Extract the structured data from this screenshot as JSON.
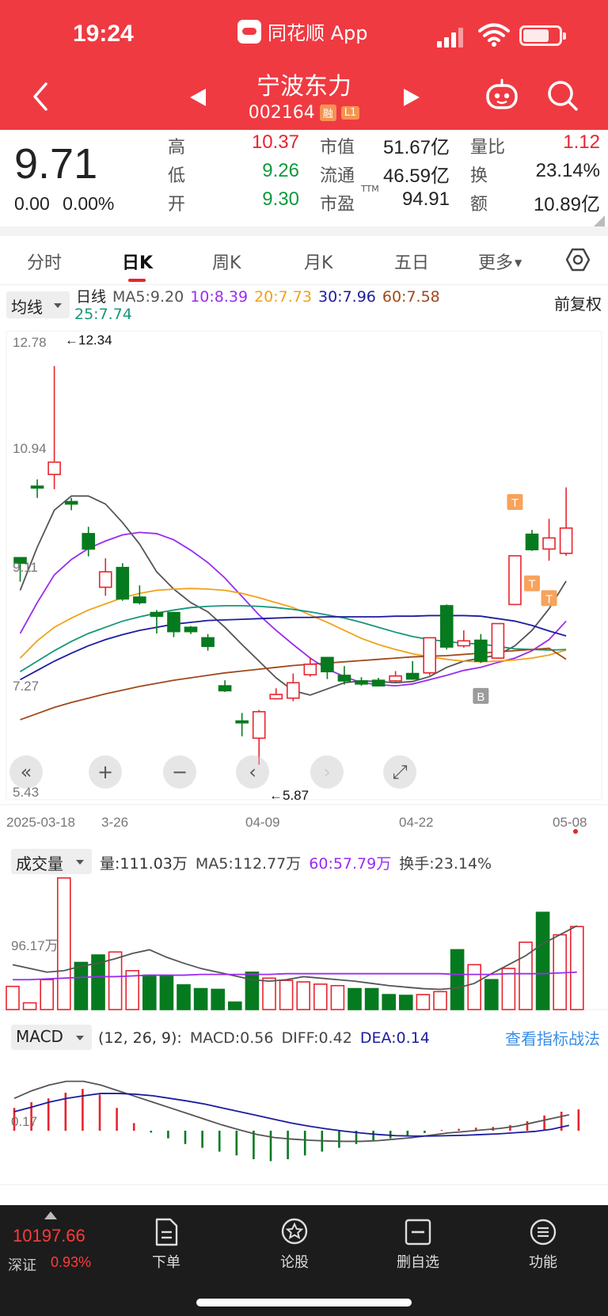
{
  "status_bar": {
    "time": "19:24",
    "app_name": "同花顺 App"
  },
  "header": {
    "stock_name": "宁波东力",
    "stock_code": "002164",
    "tags": [
      "融",
      "L1"
    ],
    "icons": [
      "back-icon",
      "prev-stock-icon",
      "next-stock-icon",
      "robot-icon",
      "search-icon"
    ]
  },
  "quote": {
    "price": "9.71",
    "change": "0.00",
    "change_pct": "0.00%",
    "high_label": "高",
    "high": "10.37",
    "low_label": "低",
    "low": "9.26",
    "open_label": "开",
    "open": "9.30",
    "mcap_label": "市值",
    "mcap": "51.67亿",
    "float_label": "流通",
    "float": "46.59亿",
    "pe_label": "市盈",
    "pe_sup": "TTM",
    "pe": "94.91",
    "volratio_label": "量比",
    "volratio": "1.12",
    "turnover_label": "换",
    "turnover": "23.14%",
    "amount_label": "额",
    "amount": "10.89亿"
  },
  "tabs": [
    "分时",
    "日K",
    "周K",
    "月K",
    "五日",
    "更多"
  ],
  "ma_legend": {
    "selector": "均线",
    "period": "日线",
    "ma5": "MA5:9.20",
    "ma10": "10:8.39",
    "ma20": "20:7.73",
    "ma30": "30:7.96",
    "ma60": "60:7.58",
    "ma25": "25:7.74",
    "fuquan": "前复权"
  },
  "colors": {
    "up": "#e8242e",
    "down": "#067a1e",
    "ma5": "#555555",
    "ma10": "#9a2cf0",
    "ma20": "#f2a218",
    "ma30": "#1c1ca0",
    "ma60": "#a0491a",
    "ma25": "#17967a"
  },
  "chart_data": [
    {
      "type": "candlestick",
      "price_axis": [
        "12.78",
        "10.94",
        "9.11",
        "7.27",
        "5.43"
      ],
      "ylim": [
        5.43,
        12.78
      ],
      "date_labels": [
        "2025-03-18",
        "3-26",
        "04-09",
        "04-22",
        "05-08"
      ],
      "annotations": {
        "high": "←12.34",
        "low": "←5.87",
        "trade_marks": [
          "T",
          "T",
          "T",
          "B"
        ]
      },
      "candles": [
        {
          "o": 9.23,
          "c": 9.14,
          "h": 9.24,
          "l": 8.84
        },
        {
          "o": 10.39,
          "c": 10.36,
          "h": 10.5,
          "l": 10.2
        },
        {
          "o": 10.58,
          "c": 10.78,
          "h": 12.34,
          "l": 10.34
        },
        {
          "o": 10.14,
          "c": 10.1,
          "h": 10.2,
          "l": 10.0
        },
        {
          "o": 9.62,
          "c": 9.37,
          "h": 9.73,
          "l": 9.25
        },
        {
          "o": 8.75,
          "c": 9.0,
          "h": 9.22,
          "l": 8.61
        },
        {
          "o": 9.07,
          "c": 8.56,
          "h": 9.14,
          "l": 8.53
        },
        {
          "o": 8.59,
          "c": 8.5,
          "h": 8.78,
          "l": 8.47
        },
        {
          "o": 8.34,
          "c": 8.28,
          "h": 8.38,
          "l": 8.0
        },
        {
          "o": 8.34,
          "c": 8.03,
          "h": 8.34,
          "l": 7.94
        },
        {
          "o": 8.1,
          "c": 8.03,
          "h": 8.12,
          "l": 7.99
        },
        {
          "o": 7.93,
          "c": 7.79,
          "h": 7.99,
          "l": 7.72
        },
        {
          "o": 7.15,
          "c": 7.07,
          "h": 7.24,
          "l": 7.05
        },
        {
          "o": 6.58,
          "c": 6.55,
          "h": 6.71,
          "l": 6.33
        },
        {
          "o": 6.3,
          "c": 6.73,
          "h": 6.76,
          "l": 5.87
        },
        {
          "o": 6.94,
          "c": 7.01,
          "h": 7.11,
          "l": 6.93
        },
        {
          "o": 6.95,
          "c": 7.2,
          "h": 7.35,
          "l": 6.9
        },
        {
          "o": 7.33,
          "c": 7.5,
          "h": 7.61,
          "l": 7.3
        },
        {
          "o": 7.61,
          "c": 7.38,
          "h": 7.61,
          "l": 7.26
        },
        {
          "o": 7.32,
          "c": 7.23,
          "h": 7.47,
          "l": 7.17
        },
        {
          "o": 7.23,
          "c": 7.18,
          "h": 7.29,
          "l": 7.15
        },
        {
          "o": 7.24,
          "c": 7.15,
          "h": 7.28,
          "l": 7.14
        },
        {
          "o": 7.23,
          "c": 7.31,
          "h": 7.39,
          "l": 7.21
        },
        {
          "o": 7.35,
          "c": 7.26,
          "h": 7.55,
          "l": 7.25
        },
        {
          "o": 7.36,
          "c": 7.93,
          "h": 7.93,
          "l": 7.32
        },
        {
          "o": 8.45,
          "c": 7.78,
          "h": 8.47,
          "l": 7.74
        },
        {
          "o": 7.8,
          "c": 7.88,
          "h": 8.05,
          "l": 7.77
        },
        {
          "o": 7.89,
          "c": 7.55,
          "h": 7.99,
          "l": 7.52
        },
        {
          "o": 7.6,
          "c": 8.16,
          "h": 8.16,
          "l": 7.59
        },
        {
          "o": 8.47,
          "c": 9.26,
          "h": 9.26,
          "l": 8.47
        },
        {
          "o": 9.61,
          "c": 9.36,
          "h": 9.68,
          "l": 9.34
        },
        {
          "o": 9.37,
          "c": 9.55,
          "h": 9.86,
          "l": 9.18
        },
        {
          "o": 9.3,
          "c": 9.71,
          "h": 10.37,
          "l": 9.26
        }
      ],
      "series": [
        {
          "name": "MA5",
          "values": [
            8.7,
            9.4,
            10.0,
            10.23,
            10.23,
            10.1,
            9.8,
            9.45,
            9.0,
            8.72,
            8.5,
            8.35,
            8.1,
            7.82,
            7.55,
            7.28,
            7.07,
            7.0,
            7.1,
            7.2,
            7.23,
            7.22,
            7.2,
            7.22,
            7.3,
            7.45,
            7.55,
            7.6,
            7.65,
            7.8,
            8.05,
            8.4,
            8.85
          ]
        },
        {
          "name": "MA10",
          "values": [
            8.0,
            8.5,
            8.95,
            9.2,
            9.38,
            9.5,
            9.6,
            9.64,
            9.62,
            9.52,
            9.35,
            9.15,
            8.9,
            8.6,
            8.3,
            8.05,
            7.82,
            7.6,
            7.42,
            7.3,
            7.2,
            7.17,
            7.15,
            7.18,
            7.25,
            7.32,
            7.4,
            7.45,
            7.53,
            7.6,
            7.72,
            7.9,
            8.2
          ]
        },
        {
          "name": "20",
          "values": [
            7.6,
            7.88,
            8.1,
            8.25,
            8.38,
            8.48,
            8.58,
            8.65,
            8.7,
            8.72,
            8.73,
            8.72,
            8.7,
            8.65,
            8.58,
            8.5,
            8.42,
            8.3,
            8.18,
            8.05,
            7.92,
            7.82,
            7.74,
            7.67,
            7.62,
            7.58,
            7.55,
            7.54,
            7.55,
            7.57,
            7.6,
            7.65,
            7.73
          ]
        },
        {
          "name": "25",
          "values": [
            7.38,
            7.55,
            7.72,
            7.87,
            8.0,
            8.1,
            8.2,
            8.27,
            8.33,
            8.38,
            8.42,
            8.44,
            8.45,
            8.45,
            8.44,
            8.42,
            8.39,
            8.35,
            8.3,
            8.25,
            8.18,
            8.1,
            8.02,
            7.95,
            7.9,
            7.87,
            7.84,
            7.83,
            7.79,
            7.75,
            7.74,
            7.73,
            7.74
          ]
        },
        {
          "name": "30",
          "values": [
            7.25,
            7.4,
            7.55,
            7.68,
            7.8,
            7.9,
            7.98,
            8.05,
            8.1,
            8.15,
            8.18,
            8.21,
            8.22,
            8.23,
            8.24,
            8.25,
            8.26,
            8.26,
            8.27,
            8.27,
            8.27,
            8.27,
            8.28,
            8.28,
            8.29,
            8.29,
            8.29,
            8.28,
            8.24,
            8.2,
            8.13,
            8.04,
            7.96
          ]
        },
        {
          "name": "60",
          "values": [
            6.6,
            6.7,
            6.8,
            6.88,
            6.95,
            7.02,
            7.08,
            7.14,
            7.19,
            7.24,
            7.28,
            7.32,
            7.36,
            7.39,
            7.42,
            7.45,
            7.48,
            7.5,
            7.52,
            7.54,
            7.56,
            7.58,
            7.6,
            7.62,
            7.63,
            7.64,
            7.66,
            7.68,
            7.7,
            7.72,
            7.74,
            7.76,
            7.58
          ]
        }
      ]
    },
    {
      "type": "bar",
      "title": "成交量",
      "legend": {
        "vol": "量:111.03万",
        "ma5": "MA5:112.77万",
        "ma60": "60:57.79万",
        "turnover": "换手:23.14%"
      },
      "axis_label": "96.17万",
      "ylim": [
        0,
        180
      ],
      "values": [
        31,
        9,
        40,
        176,
        63,
        73,
        77,
        52,
        46,
        45,
        33,
        28,
        27,
        10,
        50,
        42,
        39,
        37,
        34,
        32,
        28,
        28,
        20,
        19,
        20,
        24,
        80,
        60,
        40,
        55,
        90,
        130,
        100,
        111
      ],
      "directions": [
        "u",
        "u",
        "u",
        "u",
        "d",
        "d",
        "u",
        "u",
        "d",
        "d",
        "d",
        "d",
        "d",
        "d",
        "d",
        "u",
        "u",
        "u",
        "u",
        "u",
        "d",
        "d",
        "d",
        "d",
        "u",
        "u",
        "d",
        "u",
        "d",
        "u",
        "u",
        "d",
        "u",
        "u"
      ],
      "series": [
        {
          "name": "MA5",
          "values": [
            60,
            55,
            50,
            52,
            58,
            62,
            68,
            75,
            80,
            70,
            62,
            55,
            50,
            45,
            40,
            38,
            40,
            44,
            42,
            40,
            38,
            35,
            32,
            30,
            28,
            27,
            29,
            35,
            48,
            60,
            72,
            88,
            100,
            112
          ]
        },
        {
          "name": "60",
          "values": [
            40,
            40,
            41,
            42,
            43,
            44,
            44,
            45,
            46,
            46,
            46,
            47,
            47,
            47,
            47,
            47,
            48,
            48,
            48,
            48,
            48,
            48,
            48,
            48,
            48,
            48,
            47,
            47,
            47,
            48,
            48,
            48,
            49,
            50
          ]
        }
      ]
    },
    {
      "type": "bar",
      "title": "MACD",
      "legend": {
        "params": "(12, 26, 9):",
        "macd": "MACD:0.56",
        "diff": "DIFF:0.42",
        "dea": "DEA:0.14"
      },
      "axis_label": "0.17",
      "link": "查看指标战法",
      "ylim": [
        -1.4,
        1.4
      ],
      "values": [
        0.6,
        0.75,
        0.85,
        1.0,
        1.1,
        0.95,
        0.6,
        0.2,
        -0.05,
        -0.2,
        -0.35,
        -0.45,
        -0.55,
        -0.65,
        -0.75,
        -0.8,
        -0.75,
        -0.65,
        -0.55,
        -0.45,
        -0.35,
        -0.28,
        -0.2,
        -0.12,
        -0.06,
        0.02,
        0.05,
        0.08,
        0.1,
        0.15,
        0.25,
        0.4,
        0.5,
        0.56
      ],
      "series": [
        {
          "name": "DIFF",
          "values": [
            0.85,
            1.05,
            1.2,
            1.3,
            1.3,
            1.2,
            1.05,
            0.9,
            0.75,
            0.6,
            0.45,
            0.3,
            0.15,
            0.02,
            -0.1,
            -0.18,
            -0.22,
            -0.25,
            -0.27,
            -0.28,
            -0.28,
            -0.26,
            -0.22,
            -0.18,
            -0.12,
            -0.06,
            -0.02,
            0.02,
            0.06,
            0.12,
            0.22,
            0.32,
            0.42
          ]
        },
        {
          "name": "DEA",
          "values": [
            0.5,
            0.62,
            0.75,
            0.85,
            0.92,
            0.98,
            0.98,
            0.96,
            0.92,
            0.85,
            0.78,
            0.7,
            0.6,
            0.5,
            0.4,
            0.3,
            0.2,
            0.12,
            0.05,
            -0.01,
            -0.06,
            -0.1,
            -0.13,
            -0.14,
            -0.14,
            -0.13,
            -0.12,
            -0.1,
            -0.08,
            -0.05,
            -0.02,
            0.04,
            0.14
          ]
        }
      ]
    }
  ],
  "chart_controls": [
    "collapse-icon",
    "zoom-in-icon",
    "zoom-out-icon",
    "scroll-left-icon",
    "scroll-right-icon",
    "fullscreen-icon"
  ],
  "bottom_nav": {
    "index_value": "10197.66",
    "index_name": "深证",
    "index_pct": "0.93%",
    "items": [
      "下单",
      "论股",
      "删自选",
      "功能"
    ]
  }
}
